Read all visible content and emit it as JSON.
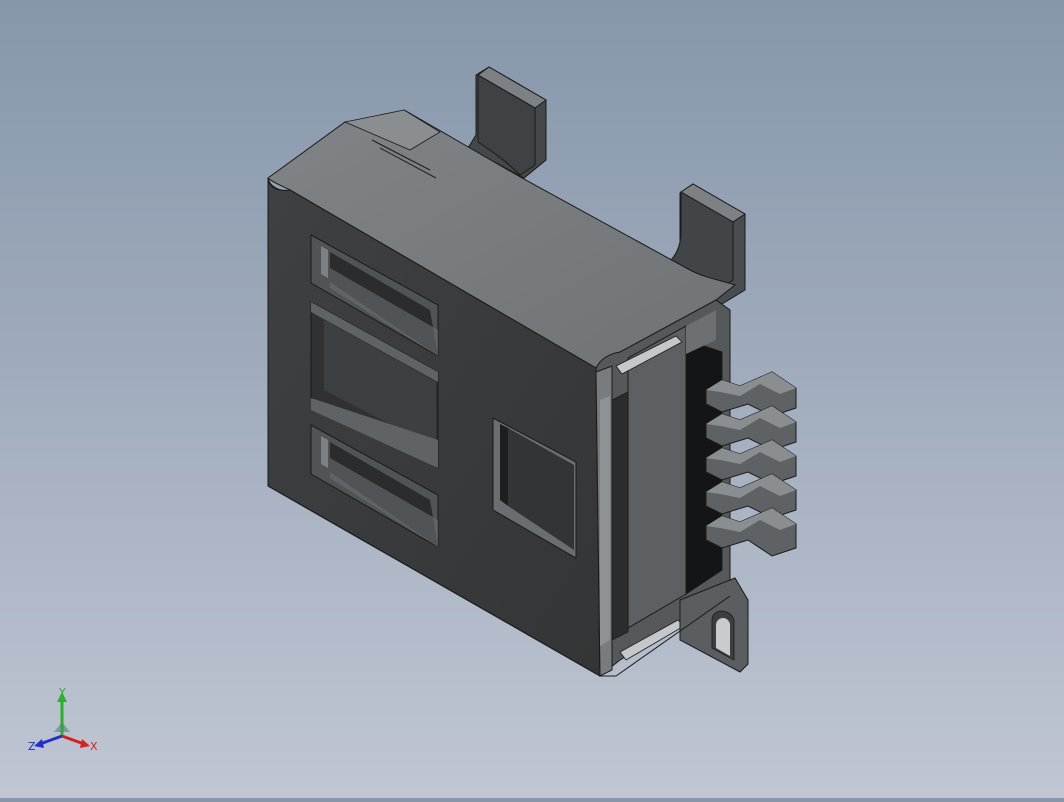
{
  "viewport": {
    "background_top": "#8796ab",
    "background_bottom": "#c0c6d3"
  },
  "model": {
    "body_color": "#3a3c3d",
    "top_color": "#7a7e80",
    "side_color": "#5c6062",
    "dark_color": "#1c1e1f",
    "pin_count": 5
  },
  "triad": {
    "x_label": "X",
    "y_label": "Y",
    "z_label": "Z",
    "x_color": "#d42020",
    "y_color": "#2cb02c",
    "z_color": "#2030c8"
  }
}
